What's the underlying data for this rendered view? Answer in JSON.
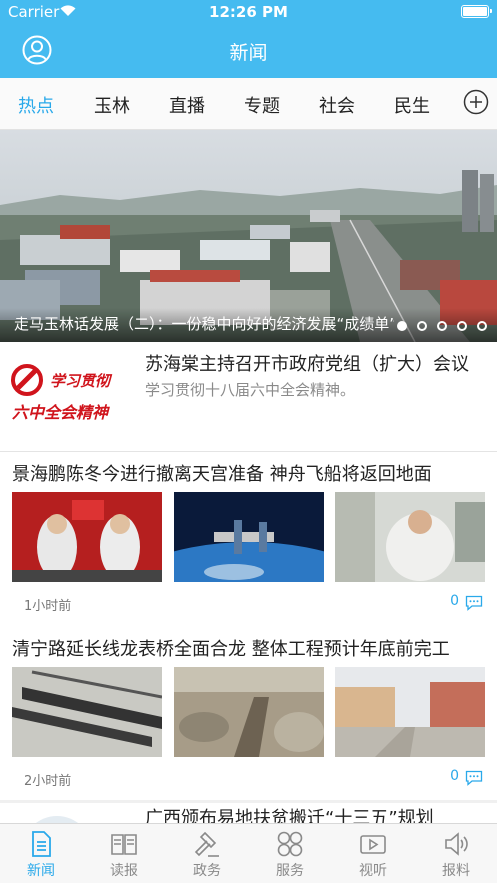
{
  "status": {
    "carrier": "Carrier",
    "time": "12:26 PM"
  },
  "navbar": {
    "title": "新闻"
  },
  "tabs": [
    {
      "label": "热点",
      "active": true
    },
    {
      "label": "玉林"
    },
    {
      "label": "直播"
    },
    {
      "label": "专题"
    },
    {
      "label": "社会"
    },
    {
      "label": "民生"
    }
  ],
  "hero": {
    "caption": "走马玉林话发展（二）：一份稳中向好的经济发展“成绩单”",
    "slides": 5,
    "active_slide": 1
  },
  "article1": {
    "title": "苏海棠主持召开市政府党组（扩大）会议",
    "subtitle": "学习贯彻十八届六中全会精神。",
    "thumb_text_1": "学习贯彻",
    "thumb_text_2": "六中全会精神"
  },
  "article2": {
    "title": "景海鹏陈冬今进行撤离天宫准备 神舟飞船将返回地面",
    "time": "1小时前",
    "comments": "0"
  },
  "article3": {
    "title": "清宁路延长线龙表桥全面合龙 整体工程预计年底前完工",
    "time": "2小时前",
    "comments": "0"
  },
  "article4": {
    "title": "广西颁布易地扶贫搬迁“十三五”规划"
  },
  "bottom_tabs": [
    {
      "label": "新闻",
      "icon": "news-icon",
      "active": true
    },
    {
      "label": "读报",
      "icon": "newspaper-icon"
    },
    {
      "label": "政务",
      "icon": "gavel-icon"
    },
    {
      "label": "服务",
      "icon": "grid-icon"
    },
    {
      "label": "视听",
      "icon": "video-icon"
    },
    {
      "label": "报料",
      "icon": "speaker-icon"
    }
  ],
  "colors": {
    "brand": "#45bbf0",
    "accent": "#2aa9ea"
  }
}
